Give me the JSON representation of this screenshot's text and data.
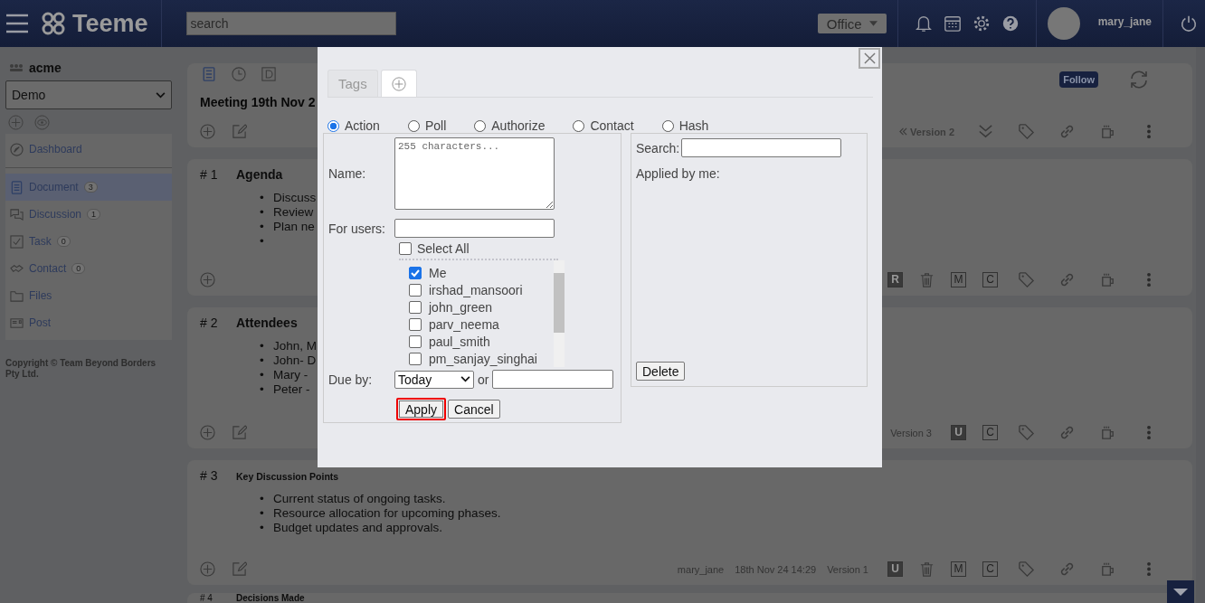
{
  "header": {
    "brand": "Teeme",
    "search": {
      "placeholder": "search"
    },
    "workspace": "Office",
    "user": "mary_jane"
  },
  "sidebar": {
    "space": "acme",
    "space_select": "Demo",
    "items": [
      {
        "kind": "dashboard",
        "label": "Dashboard",
        "selected": false
      },
      {
        "kind": "document",
        "label": "Document",
        "count": "3",
        "selected": true
      },
      {
        "kind": "discussion",
        "label": "Discussion",
        "count": "1",
        "selected": false
      },
      {
        "kind": "task",
        "label": "Task",
        "count": "0",
        "selected": false
      },
      {
        "kind": "contact",
        "label": "Contact",
        "count": "0",
        "selected": false
      },
      {
        "kind": "files",
        "label": "Files",
        "selected": false
      },
      {
        "kind": "post",
        "label": "Post",
        "selected": false
      }
    ],
    "copyright": "Copyright © Team Beyond Borders Pty Ltd."
  },
  "document": {
    "title": "Meeting 19th Nov 2",
    "follow": "Follow",
    "tools": [
      {
        "kind": "version",
        "text": "Version 2"
      },
      {
        "kind": "expand"
      },
      {
        "kind": "tag"
      },
      {
        "kind": "link"
      },
      {
        "kind": "mug"
      },
      {
        "kind": "more"
      }
    ]
  },
  "sections": [
    {
      "kind": "large",
      "number": "# 1",
      "title": "Agenda",
      "bullets": [
        {
          "marker": "•",
          "text": "Discuss"
        },
        {
          "marker": "•",
          "text": "Review"
        },
        {
          "marker": "•",
          "text": "Plan ne"
        },
        {
          "marker": "•"
        }
      ],
      "editable": false,
      "tools": [
        {
          "kind": "badge",
          "text": "R",
          "filled": true
        },
        {
          "kind": "trash"
        },
        {
          "kind": "badge",
          "text": "M",
          "filled": false
        },
        {
          "kind": "badge",
          "text": "C",
          "filled": false
        },
        {
          "kind": "tag"
        },
        {
          "kind": "link"
        },
        {
          "kind": "mug"
        },
        {
          "kind": "more"
        }
      ]
    },
    {
      "kind": "large",
      "number": "# 2",
      "title": "Attendees",
      "bullets": [
        {
          "marker": "•",
          "text": "John, M"
        },
        {
          "marker": "•",
          "text": "John- D"
        },
        {
          "marker": "•",
          "text": "Mary -"
        },
        {
          "marker": "•",
          "text": "Peter -"
        }
      ],
      "editable": true,
      "tools": [
        {
          "kind": "text",
          "text": "Version 3"
        },
        {
          "kind": "badge",
          "text": "U",
          "filled": true
        },
        {
          "kind": "badge",
          "text": "C",
          "filled": false
        },
        {
          "kind": "tag"
        },
        {
          "kind": "link"
        },
        {
          "kind": "mug"
        },
        {
          "kind": "more"
        }
      ]
    },
    {
      "kind": "small",
      "number": "# 3",
      "title": "Key Discussion Points",
      "bullets": [
        {
          "marker": "•",
          "text": "Current status of ongoing tasks."
        },
        {
          "marker": "•",
          "text": "Resource allocation for upcoming phases."
        },
        {
          "marker": "•",
          "text": "Budget updates and approvals."
        }
      ],
      "editable": true,
      "tools": [
        {
          "kind": "text",
          "text": "mary_jane"
        },
        {
          "kind": "text",
          "text": "18th Nov 24 14:29"
        },
        {
          "kind": "text",
          "text": "Version 1"
        },
        {
          "kind": "badge",
          "text": "U",
          "filled": true
        },
        {
          "kind": "trash"
        },
        {
          "kind": "badge",
          "text": "M",
          "filled": false
        },
        {
          "kind": "badge",
          "text": "C",
          "filled": false
        },
        {
          "kind": "tag"
        },
        {
          "kind": "link"
        },
        {
          "kind": "mug"
        },
        {
          "kind": "more"
        }
      ]
    },
    {
      "kind": "peek",
      "number": "# 4",
      "title": "Decisions Made"
    }
  ],
  "dialog": {
    "tabs": [
      {
        "kind": "text",
        "label": "Tags",
        "selected": false
      },
      {
        "kind": "add",
        "selected": true
      }
    ],
    "types": [
      {
        "label": "Action",
        "selected": true
      },
      {
        "label": "Poll",
        "selected": false
      },
      {
        "label": "Authorize",
        "selected": false
      },
      {
        "label": "Contact",
        "selected": false
      },
      {
        "label": "Hash",
        "selected": false
      }
    ],
    "name": {
      "label": "Name:",
      "placeholder": "255 characters..."
    },
    "for_users": {
      "label": "For users:"
    },
    "select_all": {
      "label": "Select All",
      "checked": false
    },
    "users": [
      {
        "name": "Me",
        "checked": true
      },
      {
        "name": "irshad_mansoori",
        "checked": false
      },
      {
        "name": "john_green",
        "checked": false
      },
      {
        "name": "parv_neema",
        "checked": false
      },
      {
        "name": "paul_smith",
        "checked": false
      },
      {
        "name": "pm_sanjay_singhai",
        "checked": false
      }
    ],
    "due": {
      "label": "Due by:",
      "value": "Today",
      "or": "or"
    },
    "apply": {
      "label": "Apply",
      "focused": true
    },
    "cancel": "Cancel",
    "search": {
      "label": "Search:"
    },
    "applied": "Applied by me:",
    "delete": "Delete"
  }
}
